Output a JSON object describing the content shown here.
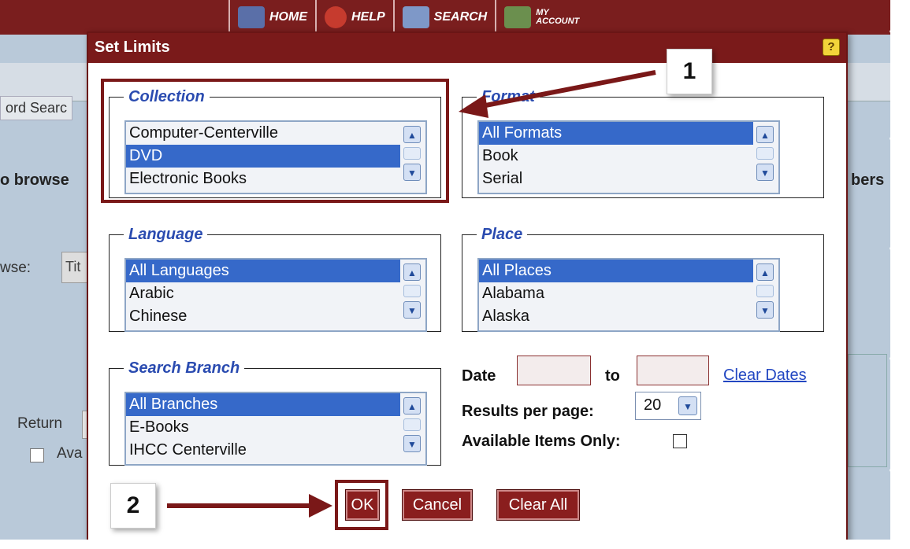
{
  "nav": {
    "home": "HOME",
    "help": "HELP",
    "search": "SEARCH",
    "account_line1": "MY",
    "account_line2": "ACCOUNT"
  },
  "background": {
    "tab": "ord Searc",
    "browse_label": "o browse",
    "browse_by": "wse:",
    "browse_value": "Tit",
    "return_label": "Return",
    "available_label": "Ava",
    "right_label": "bers"
  },
  "dialog": {
    "title": "Set Limits",
    "help": "?",
    "collection": {
      "legend": "Collection",
      "options": [
        "Computer-Centerville",
        "DVD",
        "Electronic Books"
      ],
      "selected": "DVD"
    },
    "format": {
      "legend": "Format",
      "options": [
        "All Formats",
        "Book",
        "Serial"
      ],
      "selected": "All Formats"
    },
    "language": {
      "legend": "Language",
      "options": [
        "All Languages",
        "Arabic",
        "Chinese"
      ],
      "selected": "All Languages"
    },
    "place": {
      "legend": "Place",
      "options": [
        "All Places",
        "Alabama",
        "Alaska"
      ],
      "selected": "All Places"
    },
    "branch": {
      "legend": "Search Branch",
      "options": [
        "All Branches",
        "E-Books",
        "IHCC Centerville"
      ],
      "selected": "All Branches"
    },
    "date_label": "Date",
    "date_from": "",
    "to_label": "to",
    "date_to": "",
    "clear_dates": "Clear Dates",
    "results_label": "Results per page:",
    "results_value": "20",
    "available_only_label": "Available Items Only:",
    "available_only_checked": false,
    "ok": "OK",
    "cancel": "Cancel",
    "clear_all": "Clear All"
  },
  "annotations": {
    "step1": "1",
    "step2": "2",
    "color": "#7a1818"
  },
  "colors": {
    "brand": "#7a1a1a",
    "selection": "#3669c9",
    "legend": "#2a4bb0",
    "link": "#2347c2"
  }
}
